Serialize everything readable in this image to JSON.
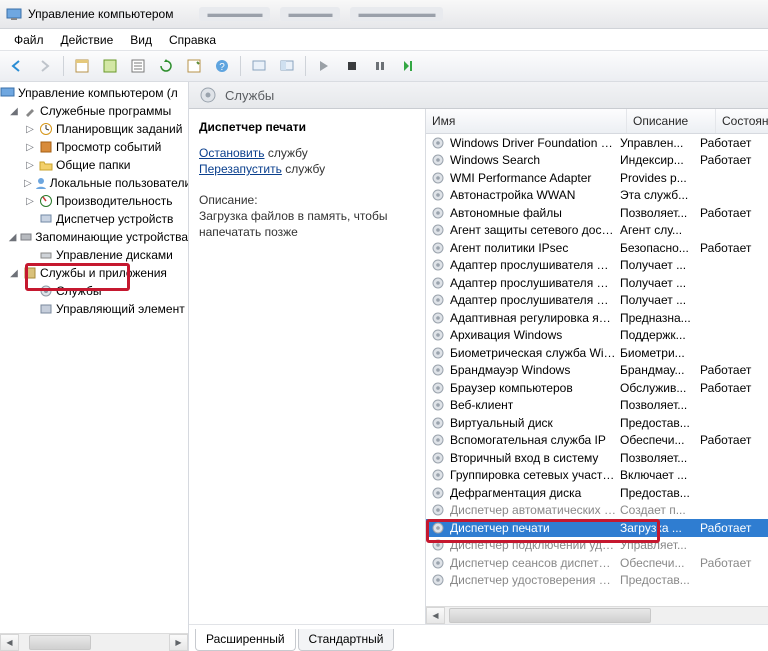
{
  "title": "Управление компьютером",
  "menu": {
    "file": "Файл",
    "action": "Действие",
    "view": "Вид",
    "help": "Справка"
  },
  "tree": {
    "root": "Управление компьютером (л",
    "group1": "Служебные программы",
    "scheduler": "Планировщик заданий",
    "events": "Просмотр событий",
    "shared": "Общие папки",
    "local_users": "Локальные пользователи",
    "perf": "Производительность",
    "devmgr": "Диспетчер устройств",
    "storage": "Запоминающие устройства",
    "diskmgr": "Управление дисками",
    "services_apps": "Службы и приложения",
    "services": "Службы",
    "wmi": "Управляющий элемент"
  },
  "header": "Службы",
  "detail": {
    "title": "Диспетчер печати",
    "stop": "Остановить",
    "stop_suffix": " службу",
    "restart": "Перезапустить",
    "restart_suffix": " службу",
    "desc_h": "Описание:",
    "desc": "Загрузка файлов в память, чтобы напечатать позже"
  },
  "cols": {
    "name": "Имя",
    "desc": "Описание",
    "state": "Состояние"
  },
  "rows": [
    {
      "n": "Windows Driver Foundation - User...",
      "d": "Управлен...",
      "s": "Работает"
    },
    {
      "n": "Windows Search",
      "d": "Индексир...",
      "s": "Работает"
    },
    {
      "n": "WMI Performance Adapter",
      "d": "Provides p...",
      "s": ""
    },
    {
      "n": "Автонастройка WWAN",
      "d": "Эта служб...",
      "s": ""
    },
    {
      "n": "Автономные файлы",
      "d": "Позволяет...",
      "s": "Работает"
    },
    {
      "n": "Агент защиты сетевого доступа",
      "d": "Агент слу...",
      "s": ""
    },
    {
      "n": "Агент политики IPsec",
      "d": "Безопасно...",
      "s": "Работает"
    },
    {
      "n": "Адаптер прослушивателя Net.M...",
      "d": "Получает ...",
      "s": ""
    },
    {
      "n": "Адаптер прослушивателя Net.Pipe",
      "d": "Получает ...",
      "s": ""
    },
    {
      "n": "Адаптер прослушивателя Net.Tcp",
      "d": "Получает ...",
      "s": ""
    },
    {
      "n": "Адаптивная регулировка яркости",
      "d": "Предназна...",
      "s": ""
    },
    {
      "n": "Архивация Windows",
      "d": "Поддержк...",
      "s": ""
    },
    {
      "n": "Биометрическая служба Windows",
      "d": "Биометри...",
      "s": ""
    },
    {
      "n": "Брандмауэр Windows",
      "d": "Брандмау...",
      "s": "Работает"
    },
    {
      "n": "Браузер компьютеров",
      "d": "Обслужив...",
      "s": "Работает"
    },
    {
      "n": "Веб-клиент",
      "d": "Позволяет...",
      "s": ""
    },
    {
      "n": "Виртуальный диск",
      "d": "Предостав...",
      "s": ""
    },
    {
      "n": "Вспомогательная служба IP",
      "d": "Обеспечи...",
      "s": "Работает"
    },
    {
      "n": "Вторичный вход в систему",
      "d": "Позволяет...",
      "s": ""
    },
    {
      "n": "Группировка сетевых участников",
      "d": "Включает ...",
      "s": ""
    },
    {
      "n": "Дефрагментация диска",
      "d": "Предостав...",
      "s": ""
    },
    {
      "n": "Диспетчер автоматических подк...",
      "d": "Создает п...",
      "s": "",
      "dim": true
    },
    {
      "n": "Диспетчер печати",
      "d": "Загрузка ...",
      "s": "Работает",
      "sel": true
    },
    {
      "n": "Диспетчер подключений удален...",
      "d": "Управляет...",
      "s": "",
      "dim": true
    },
    {
      "n": "Диспетчер сеансов диспетчера о...",
      "d": "Обеспечи...",
      "s": "Работает",
      "dim": true
    },
    {
      "n": "Диспетчер удостоверения сетев...",
      "d": "Предостав...",
      "s": "",
      "dim": true
    }
  ],
  "tabs": {
    "ext": "Расширенный",
    "std": "Стандартный"
  }
}
